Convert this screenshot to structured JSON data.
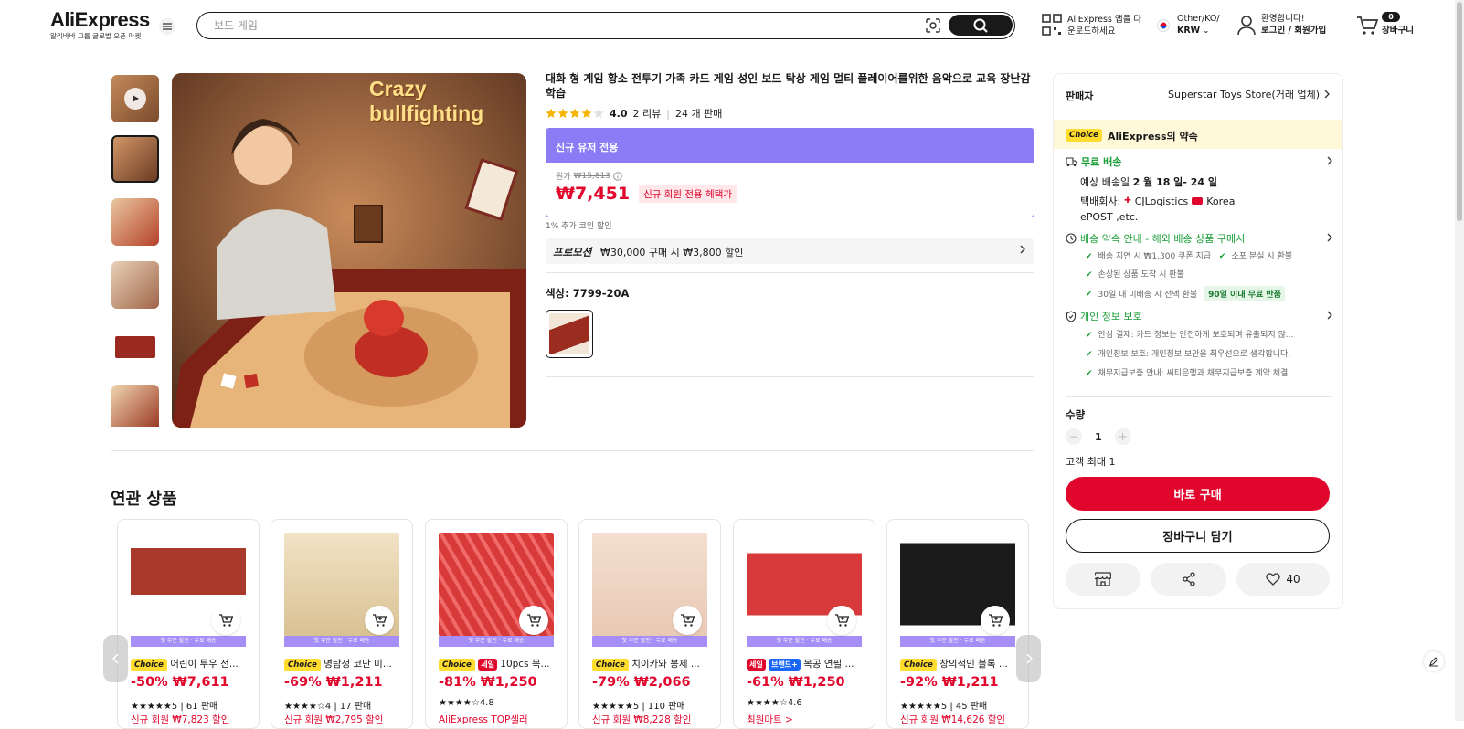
{
  "header": {
    "logo": "AliExpress",
    "logo_sub": "알리바바 그룹 글로벌 오픈 마켓",
    "search_placeholder": "보드 게임",
    "app_line1": "AliExpress 앱을 다",
    "app_line2": "운로드하세요",
    "locale_line1": "Other/KO/",
    "locale_line2": "KRW",
    "account_line1": "환영합니다!",
    "account_line2": "로그인 / 회원가입",
    "cart_count": "0",
    "cart_label": "장바구니"
  },
  "product": {
    "title": "대화 형 게임 황소 전투기 가족 카드 게임 성인 보드 탁상 게임 멀티 플레이어를위한 음악으로 교육 장난감 학습",
    "rating": "4.0",
    "reviews": "2 리뷰",
    "sold": "24 개 판매",
    "image_caption_1": "Crazy",
    "image_caption_2": "bullfighting",
    "new_user_label": "신규 유저 전용",
    "original_label": "원가",
    "original_price": "₩15,813",
    "price": "₩7,451",
    "price_tag": "신규 회원 전용 혜택가",
    "coin_note": "1% 추가 코인 할인",
    "promo_label": "프로모션",
    "promo_text": "₩30,000 구매 시 ₩3,800 할인",
    "color_label": "색상: 7799-20A"
  },
  "sidebar": {
    "seller_label": "판매자",
    "seller_name": "Superstar Toys Store(거래 업체)",
    "choice_tag": "Choice",
    "promise_title": "AliExpress의 약속",
    "free_ship": "무료 배송",
    "delivery_date_pre": "예상 배송일",
    "delivery_date": "2 월 18 일- 24 일",
    "carrier_label": "택배회사:",
    "carrier_1": "CJLogistics",
    "carrier_2": "Korea",
    "carrier_3": "ePOST ,etc.",
    "ship_promise": "배송 약속 안내 - 해외 배송 상품 구메시",
    "ship_item_1": "배송 지연 시 ₩1,300 쿠폰 지급",
    "ship_item_2": "소포 분실 시 환불",
    "ship_item_3": "손상된 상품 도착 시 환불",
    "ship_item_4": "30일 내 미배송 시 전액 환불",
    "ship_badge": "90일 이내 무료 반품",
    "privacy_title": "개인 정보 보호",
    "privacy_item_1": "안심 결제: 카드 정보는 안전하게 보호되며 유출되지 않...",
    "privacy_item_2": "개인정보 보호: 개인정보 보안을 최우선으로 생각합니다.",
    "privacy_item_3": "채무지급보증 안내: 씨티은행과 채무지급보증 계약 체결",
    "qty_label": "수량",
    "qty_value": "1",
    "qty_max": "고객 최대 1",
    "buy_now": "바로 구매",
    "add_cart": "장바구니 담기",
    "wishlist_count": "40"
  },
  "related": {
    "title": "연관 상품",
    "band_text": "첫 주문 할인 · 무료 배송",
    "items": [
      {
        "tag": "Choice",
        "name": "어린이 투우 전...",
        "price": "-50% ₩7,611",
        "rating": "★★★★★5 | 61 판매",
        "extra": "신규 회원 ₩7,823 할인"
      },
      {
        "tag": "Choice",
        "name": "명탐정 코난 미...",
        "price": "-69% ₩1,211",
        "rating": "★★★★☆4 | 17 판매",
        "extra": "신규 회원 ₩2,795 할인"
      },
      {
        "tag": "Choice",
        "tag2": "세일",
        "name": "10pcs 목...",
        "price": "-81% ₩1,250",
        "rating": "★★★★☆4.8",
        "extra": "AliExpress TOP셀러"
      },
      {
        "tag": "Choice",
        "name": "치이카와 봉제 ...",
        "price": "-79% ₩2,066",
        "rating": "★★★★★5 | 110 판매",
        "extra": "신규 회원 ₩8,228 할인"
      },
      {
        "tag": "세일",
        "tag2": "브랜드+",
        "name": "목공 연필 ...",
        "price": "-61% ₩1,250",
        "rating": "★★★★☆4.6",
        "extra": "최원마트 >"
      },
      {
        "tag": "Choice",
        "name": "창의적인 블록 ...",
        "price": "-92% ₩1,211",
        "rating": "★★★★★5 | 45 판매",
        "extra": "신규 회원 ₩14,626 할인"
      }
    ]
  },
  "colors": {
    "accent_red": "#e1062c",
    "promo_purple": "#8b7cf6",
    "choice_yellow": "#ffdc2e",
    "green": "#1a9e38"
  }
}
